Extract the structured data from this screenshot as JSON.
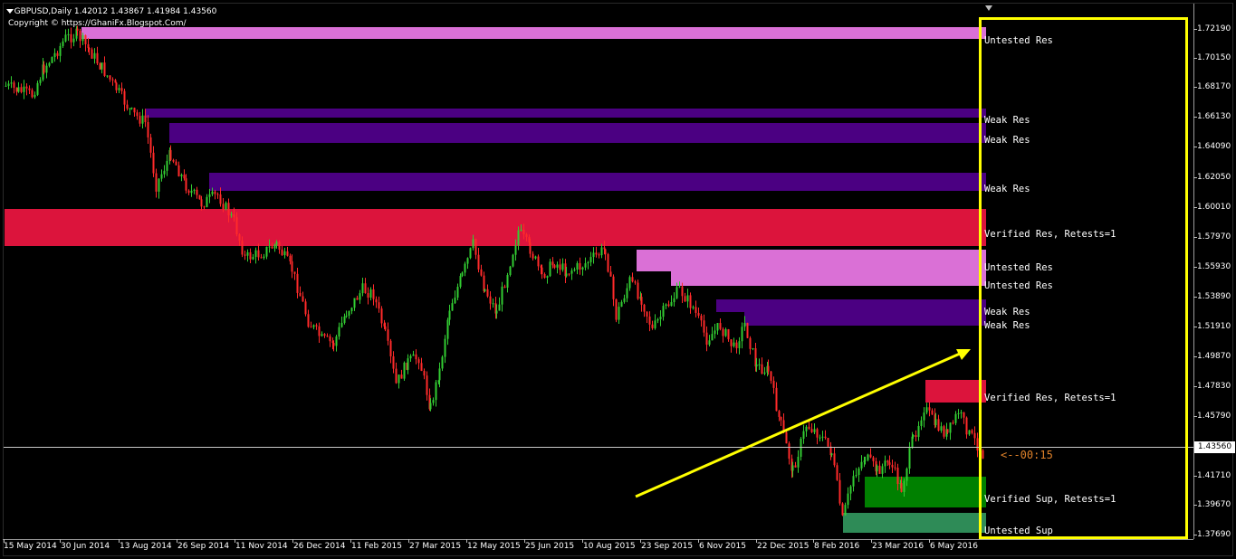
{
  "window": {
    "symbol_info": "GBPUSD,Daily  1.42012 1.43867 1.41984 1.43560",
    "copyright": "Copyright © https://GhaniFx.Blogspot.Com/",
    "timer": "<--00:15",
    "current_price": "1.43560"
  },
  "colors": {
    "background": "#000000",
    "bull_candle": "#32cd32",
    "bear_candle": "#ff2a2a",
    "untested_res": "#da70d6",
    "weak_res": "#4b0082",
    "verified_res": "#dc143c",
    "verified_sup": "#008000",
    "untested_sup": "#2e8b57",
    "highlight": "#ffff00",
    "arrow": "#ffff00"
  },
  "price_axis": {
    "labels": [
      "1.72190",
      "1.70150",
      "1.68170",
      "1.66130",
      "1.64090",
      "1.62050",
      "1.60010",
      "1.57970",
      "1.55930",
      "1.53890",
      "1.51910",
      "1.49870",
      "1.47830",
      "1.45790",
      "1.41710",
      "1.39670",
      "1.37690"
    ]
  },
  "time_axis": {
    "labels": [
      "15 May 2014",
      "30 Jun 2014",
      "13 Aug 2014",
      "26 Sep 2014",
      "11 Nov 2014",
      "26 Dec 2014",
      "11 Feb 2015",
      "27 Mar 2015",
      "12 May 2015",
      "25 Jun 2015",
      "10 Aug 2015",
      "23 Sep 2015",
      "6 Nov 2015",
      "22 Dec 2015",
      "8 Feb 2016",
      "23 Mar 2016",
      "6 May 2016"
    ]
  },
  "zones": [
    {
      "label": "Untested Res",
      "type": "untested_res"
    },
    {
      "label": "Weak Res",
      "type": "weak_res"
    },
    {
      "label": "Weak Res",
      "type": "weak_res"
    },
    {
      "label": "Weak Res",
      "type": "weak_res"
    },
    {
      "label": "Verified Res, Retests=1",
      "type": "verified_res"
    },
    {
      "label": "Untested Res",
      "type": "untested_res"
    },
    {
      "label": "Untested Res",
      "type": "untested_res"
    },
    {
      "label": "Weak Res",
      "type": "weak_res"
    },
    {
      "label": "Weak Res",
      "type": "weak_res"
    },
    {
      "label": "Verified Res, Retests=1",
      "type": "verified_res"
    },
    {
      "label": "Verified Sup, Retests=1",
      "type": "verified_sup"
    },
    {
      "label": "Untested Sup",
      "type": "untested_sup"
    }
  ]
}
